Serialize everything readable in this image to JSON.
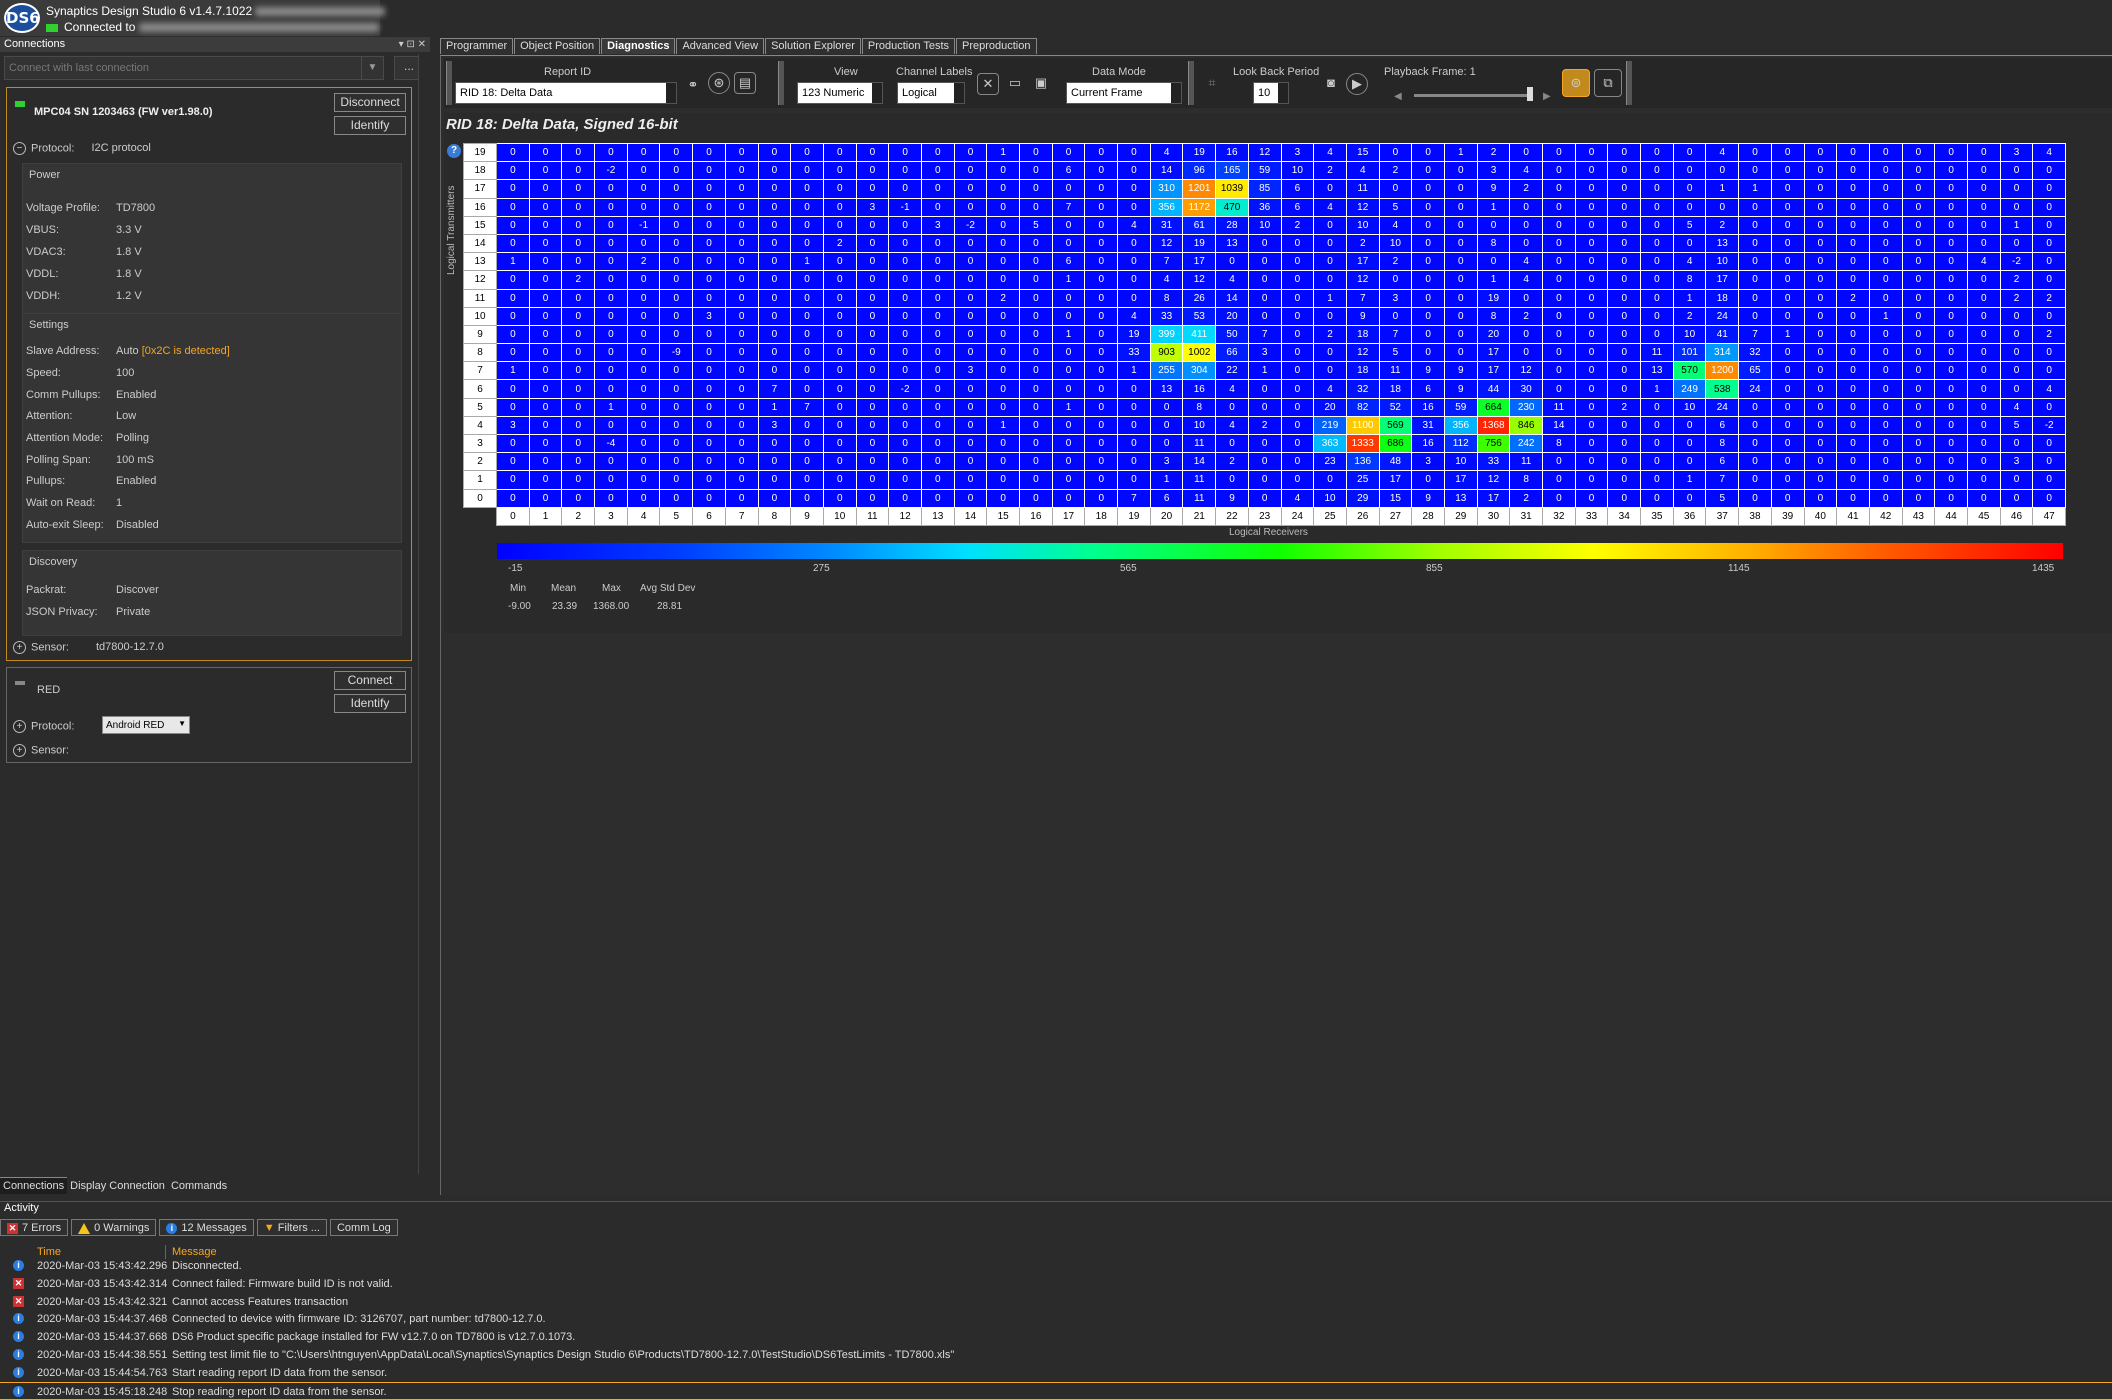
{
  "app": {
    "logo": "DS6",
    "title": "Synaptics Design Studio 6 v1.4.7.1022",
    "connected_to": "Connected to"
  },
  "connections": {
    "header": "Connections",
    "header_buttons": "▾ ⊡ ✕",
    "connect_last": "Connect with last connection",
    "dots": "...",
    "device1": {
      "name": "MPC04 SN 1203463 (FW ver1.98.0)",
      "disconnect": "Disconnect",
      "identify": "Identify",
      "protocol_label": "Protocol:",
      "protocol_value": "I2C protocol",
      "power": {
        "title": "Power",
        "rows": [
          {
            "k": "Voltage Profile:",
            "v": "TD7800"
          },
          {
            "k": "VBUS:",
            "v": "3.3  V"
          },
          {
            "k": "VDAC3:",
            "v": "1.8  V"
          },
          {
            "k": "VDDL:",
            "v": "1.8  V"
          },
          {
            "k": "VDDH:",
            "v": "1.2  V"
          }
        ]
      },
      "settings": {
        "title": "Settings",
        "slave_label": "Slave Address:",
        "slave_value": "Auto",
        "slave_detected": "[0x2C is detected]",
        "rows": [
          {
            "k": "Speed:",
            "v": "100"
          },
          {
            "k": "Comm Pullups:",
            "v": "Enabled"
          },
          {
            "k": "Attention:",
            "v": "Low"
          },
          {
            "k": "Attention Mode:",
            "v": "Polling"
          },
          {
            "k": "Polling Span:",
            "v": "100  mS"
          },
          {
            "k": "Pullups:",
            "v": "Enabled"
          },
          {
            "k": "Wait on Read:",
            "v": "1"
          },
          {
            "k": "Auto-exit Sleep:",
            "v": "Disabled"
          }
        ]
      },
      "discovery": {
        "title": "Discovery",
        "rows": [
          {
            "k": "Packrat:",
            "v": "Discover"
          },
          {
            "k": "JSON Privacy:",
            "v": "Private"
          }
        ]
      },
      "sensor_label": "Sensor:",
      "sensor_value": "td7800-12.7.0"
    },
    "device2": {
      "name": "RED",
      "connect": "Connect",
      "identify": "Identify",
      "protocol_label": "Protocol:",
      "protocol_value": "Android RED",
      "sensor_label": "Sensor:"
    },
    "bottom_tabs": [
      "Connections",
      "Display Connection",
      "Commands"
    ]
  },
  "tabs": [
    "Programmer",
    "Object Position",
    "Diagnostics",
    "Advanced View",
    "Solution Explorer",
    "Production Tests",
    "Preproduction"
  ],
  "active_tab": "Diagnostics",
  "toolbar": {
    "report_id_label": "Report ID",
    "report_id_value": "RID 18: Delta Data",
    "view_label": "View",
    "view_value": "123  Numeric",
    "channel_labels_label": "Channel Labels",
    "channel_labels_value": "Logical",
    "data_mode_label": "Data Mode",
    "data_mode_value": "Current Frame",
    "lookback_label": "Look Back Period",
    "lookback_value": "10",
    "playback_label": "Playback Frame: 1"
  },
  "heatmap": {
    "title": "RID 18: Delta Data, Signed 16-bit",
    "help": "?",
    "ylabel": "Logical Transmitters",
    "xlabel": "Logical Receivers",
    "colorbar_ticks": [
      "-15",
      "275",
      "565",
      "855",
      "1145",
      "1435"
    ],
    "stats": {
      "min_label": "Min",
      "mean_label": "Mean",
      "max_label": "Max",
      "std_label": "Avg Std Dev",
      "min": "-9.00",
      "mean": "23.39",
      "max": "1368.00",
      "std": "28.81"
    }
  },
  "chart_data": {
    "type": "heatmap",
    "title": "RID 18: Delta Data, Signed 16-bit",
    "xlabel": "Logical Receivers",
    "ylabel": "Logical Transmitters",
    "color_range": [
      -15,
      1435
    ],
    "rows_top_to_bottom": [
      19,
      18,
      17,
      16,
      15,
      14,
      13,
      12,
      11,
      10,
      9,
      8,
      7,
      6,
      5,
      4,
      3,
      2,
      1,
      0
    ],
    "columns": [
      0,
      1,
      2,
      3,
      4,
      5,
      6,
      7,
      8,
      9,
      10,
      11,
      12,
      13,
      14,
      15,
      16,
      17,
      18,
      19,
      20,
      21,
      22,
      23,
      24,
      25,
      26,
      27,
      28,
      29,
      30,
      31,
      32,
      33,
      34,
      35,
      36,
      37,
      38,
      39,
      40,
      41,
      42,
      43,
      44,
      45,
      46,
      47
    ],
    "values": [
      [
        0,
        0,
        0,
        0,
        0,
        0,
        0,
        0,
        0,
        0,
        0,
        0,
        0,
        0,
        0,
        1,
        0,
        0,
        0,
        0,
        4,
        19,
        16,
        12,
        3,
        4,
        15,
        0,
        0,
        1,
        2,
        0,
        0,
        0,
        0,
        0,
        0,
        4,
        0,
        0,
        0,
        0,
        0,
        0,
        0,
        0,
        3,
        4
      ],
      [
        0,
        0,
        0,
        -2,
        0,
        0,
        0,
        0,
        0,
        0,
        0,
        0,
        0,
        0,
        0,
        0,
        0,
        6,
        0,
        0,
        14,
        96,
        165,
        59,
        10,
        2,
        4,
        2,
        0,
        0,
        3,
        4,
        0,
        0,
        0,
        0,
        0,
        0,
        0,
        0,
        0,
        0,
        0,
        0,
        0,
        0,
        0,
        0
      ],
      [
        0,
        0,
        0,
        0,
        0,
        0,
        0,
        0,
        0,
        0,
        0,
        0,
        0,
        0,
        0,
        0,
        0,
        0,
        0,
        0,
        310,
        1201,
        1039,
        85,
        6,
        0,
        11,
        0,
        0,
        0,
        9,
        2,
        0,
        0,
        0,
        0,
        0,
        1,
        1,
        0,
        0,
        0,
        0,
        0,
        0,
        0,
        0,
        0
      ],
      [
        0,
        0,
        0,
        0,
        0,
        0,
        0,
        0,
        0,
        0,
        0,
        3,
        -1,
        0,
        0,
        0,
        0,
        7,
        0,
        0,
        356,
        1172,
        470,
        36,
        6,
        4,
        12,
        5,
        0,
        0,
        1,
        0,
        0,
        0,
        0,
        0,
        0,
        0,
        0,
        0,
        0,
        0,
        0,
        0,
        0,
        0,
        0,
        0
      ],
      [
        0,
        0,
        0,
        0,
        -1,
        0,
        0,
        0,
        0,
        0,
        0,
        0,
        0,
        3,
        -2,
        0,
        5,
        0,
        0,
        4,
        31,
        61,
        28,
        10,
        2,
        0,
        10,
        4,
        0,
        0,
        0,
        0,
        0,
        0,
        0,
        0,
        5,
        2,
        0,
        0,
        0,
        0,
        0,
        0,
        0,
        0,
        1,
        0
      ],
      [
        0,
        0,
        0,
        0,
        0,
        0,
        0,
        0,
        0,
        0,
        2,
        0,
        0,
        0,
        0,
        0,
        0,
        0,
        0,
        0,
        12,
        19,
        13,
        0,
        0,
        0,
        2,
        10,
        0,
        0,
        8,
        0,
        0,
        0,
        0,
        0,
        0,
        13,
        0,
        0,
        0,
        0,
        0,
        0,
        0,
        0,
        0,
        0
      ],
      [
        1,
        0,
        0,
        0,
        2,
        0,
        0,
        0,
        0,
        1,
        0,
        0,
        0,
        0,
        0,
        0,
        0,
        6,
        0,
        0,
        7,
        17,
        0,
        0,
        0,
        0,
        17,
        2,
        0,
        0,
        0,
        4,
        0,
        0,
        0,
        0,
        4,
        10,
        0,
        0,
        0,
        0,
        0,
        0,
        0,
        4,
        -2,
        0
      ],
      [
        0,
        0,
        2,
        0,
        0,
        0,
        0,
        0,
        0,
        0,
        0,
        0,
        0,
        0,
        0,
        0,
        0,
        1,
        0,
        0,
        4,
        12,
        4,
        0,
        0,
        0,
        12,
        0,
        0,
        0,
        1,
        4,
        0,
        0,
        0,
        0,
        8,
        17,
        0,
        0,
        0,
        0,
        0,
        0,
        0,
        0,
        2,
        0
      ],
      [
        0,
        0,
        0,
        0,
        0,
        0,
        0,
        0,
        0,
        0,
        0,
        0,
        0,
        0,
        0,
        2,
        0,
        0,
        0,
        0,
        8,
        26,
        14,
        0,
        0,
        1,
        7,
        3,
        0,
        0,
        19,
        0,
        0,
        0,
        0,
        0,
        1,
        18,
        0,
        0,
        0,
        2,
        0,
        0,
        0,
        0,
        2,
        2
      ],
      [
        0,
        0,
        0,
        0,
        0,
        0,
        3,
        0,
        0,
        0,
        0,
        0,
        0,
        0,
        0,
        0,
        0,
        0,
        0,
        4,
        33,
        53,
        20,
        0,
        0,
        0,
        9,
        0,
        0,
        0,
        8,
        2,
        0,
        0,
        0,
        0,
        2,
        24,
        0,
        0,
        0,
        0,
        1,
        0,
        0,
        0,
        0,
        0
      ],
      [
        0,
        0,
        0,
        0,
        0,
        0,
        0,
        0,
        0,
        0,
        0,
        0,
        0,
        0,
        0,
        0,
        0,
        1,
        0,
        19,
        399,
        411,
        50,
        7,
        0,
        2,
        18,
        7,
        0,
        0,
        20,
        0,
        0,
        0,
        0,
        0,
        10,
        41,
        7,
        1,
        0,
        0,
        0,
        0,
        0,
        0,
        0,
        2
      ],
      [
        0,
        0,
        0,
        0,
        0,
        -9,
        0,
        0,
        0,
        0,
        0,
        0,
        0,
        0,
        0,
        0,
        0,
        0,
        0,
        33,
        903,
        1002,
        66,
        3,
        0,
        0,
        12,
        5,
        0,
        0,
        17,
        0,
        0,
        0,
        0,
        11,
        101,
        314,
        32,
        0,
        0,
        0,
        0,
        0,
        0,
        0,
        0,
        0
      ],
      [
        1,
        0,
        0,
        0,
        0,
        0,
        0,
        0,
        0,
        0,
        0,
        0,
        0,
        0,
        3,
        0,
        0,
        0,
        0,
        1,
        255,
        304,
        22,
        1,
        0,
        0,
        18,
        11,
        9,
        9,
        17,
        12,
        0,
        0,
        0,
        13,
        570,
        1200,
        65,
        0,
        0,
        0,
        0,
        0,
        0,
        0,
        0,
        0
      ],
      [
        0,
        0,
        0,
        0,
        0,
        0,
        0,
        0,
        7,
        0,
        0,
        0,
        -2,
        0,
        0,
        0,
        0,
        0,
        0,
        0,
        13,
        16,
        4,
        0,
        0,
        4,
        32,
        18,
        6,
        9,
        44,
        30,
        0,
        0,
        0,
        1,
        249,
        538,
        24,
        0,
        0,
        0,
        0,
        0,
        0,
        0,
        0,
        4
      ],
      [
        0,
        0,
        0,
        1,
        0,
        0,
        0,
        0,
        1,
        7,
        0,
        0,
        0,
        0,
        0,
        0,
        0,
        1,
        0,
        0,
        0,
        8,
        0,
        0,
        0,
        20,
        82,
        52,
        16,
        59,
        664,
        230,
        11,
        0,
        2,
        0,
        10,
        24,
        0,
        0,
        0,
        0,
        0,
        0,
        0,
        0,
        4,
        0
      ],
      [
        3,
        0,
        0,
        0,
        0,
        0,
        0,
        0,
        3,
        0,
        0,
        0,
        0,
        0,
        0,
        1,
        0,
        0,
        0,
        0,
        0,
        10,
        4,
        2,
        0,
        219,
        1100,
        569,
        31,
        356,
        1368,
        846,
        14,
        0,
        0,
        0,
        0,
        6,
        0,
        0,
        0,
        0,
        0,
        0,
        0,
        0,
        5,
        -2
      ],
      [
        0,
        0,
        0,
        -4,
        0,
        0,
        0,
        0,
        0,
        0,
        0,
        0,
        0,
        0,
        0,
        0,
        0,
        0,
        0,
        0,
        0,
        11,
        0,
        0,
        0,
        363,
        1333,
        686,
        16,
        112,
        756,
        242,
        8,
        0,
        0,
        0,
        0,
        8,
        0,
        0,
        0,
        0,
        0,
        0,
        0,
        0,
        0,
        0
      ],
      [
        0,
        0,
        0,
        0,
        0,
        0,
        0,
        0,
        0,
        0,
        0,
        0,
        0,
        0,
        0,
        0,
        0,
        0,
        0,
        0,
        3,
        14,
        2,
        0,
        0,
        23,
        136,
        48,
        3,
        10,
        33,
        11,
        0,
        0,
        0,
        0,
        0,
        6,
        0,
        0,
        0,
        0,
        0,
        0,
        0,
        0,
        3,
        0
      ],
      [
        0,
        0,
        0,
        0,
        0,
        0,
        0,
        0,
        0,
        0,
        0,
        0,
        0,
        0,
        0,
        0,
        0,
        0,
        0,
        0,
        1,
        11,
        0,
        0,
        0,
        0,
        25,
        17,
        0,
        17,
        12,
        8,
        0,
        0,
        0,
        0,
        1,
        7,
        0,
        0,
        0,
        0,
        0,
        0,
        0,
        0,
        0,
        0
      ],
      [
        0,
        0,
        0,
        0,
        0,
        0,
        0,
        0,
        0,
        0,
        0,
        0,
        0,
        0,
        0,
        0,
        0,
        0,
        0,
        7,
        6,
        11,
        9,
        0,
        4,
        10,
        29,
        15,
        9,
        13,
        17,
        2,
        0,
        0,
        0,
        0,
        0,
        5,
        0,
        0,
        0,
        0,
        0,
        0,
        0,
        0,
        0,
        0
      ]
    ]
  },
  "activity": {
    "header": "Activity",
    "errors": "7  Errors",
    "warnings": "0  Warnings",
    "messages": "12  Messages",
    "filters": "Filters ...",
    "comm_log": "Comm Log",
    "col_time": "Time",
    "col_message": "Message",
    "rows": [
      {
        "type": "info",
        "time": "2020-Mar-03 15:43:42.296",
        "msg": "Disconnected."
      },
      {
        "type": "error",
        "time": "2020-Mar-03 15:43:42.314",
        "msg": "Connect failed: Firmware build ID is not valid."
      },
      {
        "type": "error",
        "time": "2020-Mar-03 15:43:42.321",
        "msg": "Cannot access Features transaction"
      },
      {
        "type": "info",
        "time": "2020-Mar-03 15:44:37.468",
        "msg": "Connected to device with firmware ID: 3126707, part number: td7800-12.7.0."
      },
      {
        "type": "info",
        "time": "2020-Mar-03 15:44:37.668",
        "msg": "DS6 Product specific package installed for FW v12.7.0 on TD7800 is v12.7.0.1073."
      },
      {
        "type": "info",
        "time": "2020-Mar-03 15:44:38.551",
        "msg": "Setting test limit file to \"C:\\Users\\htnguyen\\AppData\\Local\\Synaptics\\Synaptics Design Studio 6\\Products\\TD7800-12.7.0\\TestStudio\\DS6TestLimits - TD7800.xls\""
      },
      {
        "type": "info",
        "time": "2020-Mar-03 15:44:54.763",
        "msg": "Start reading report ID data from the sensor."
      },
      {
        "type": "info",
        "time": "2020-Mar-03 15:45:18.248",
        "msg": "Stop reading report ID data from the sensor."
      }
    ]
  }
}
